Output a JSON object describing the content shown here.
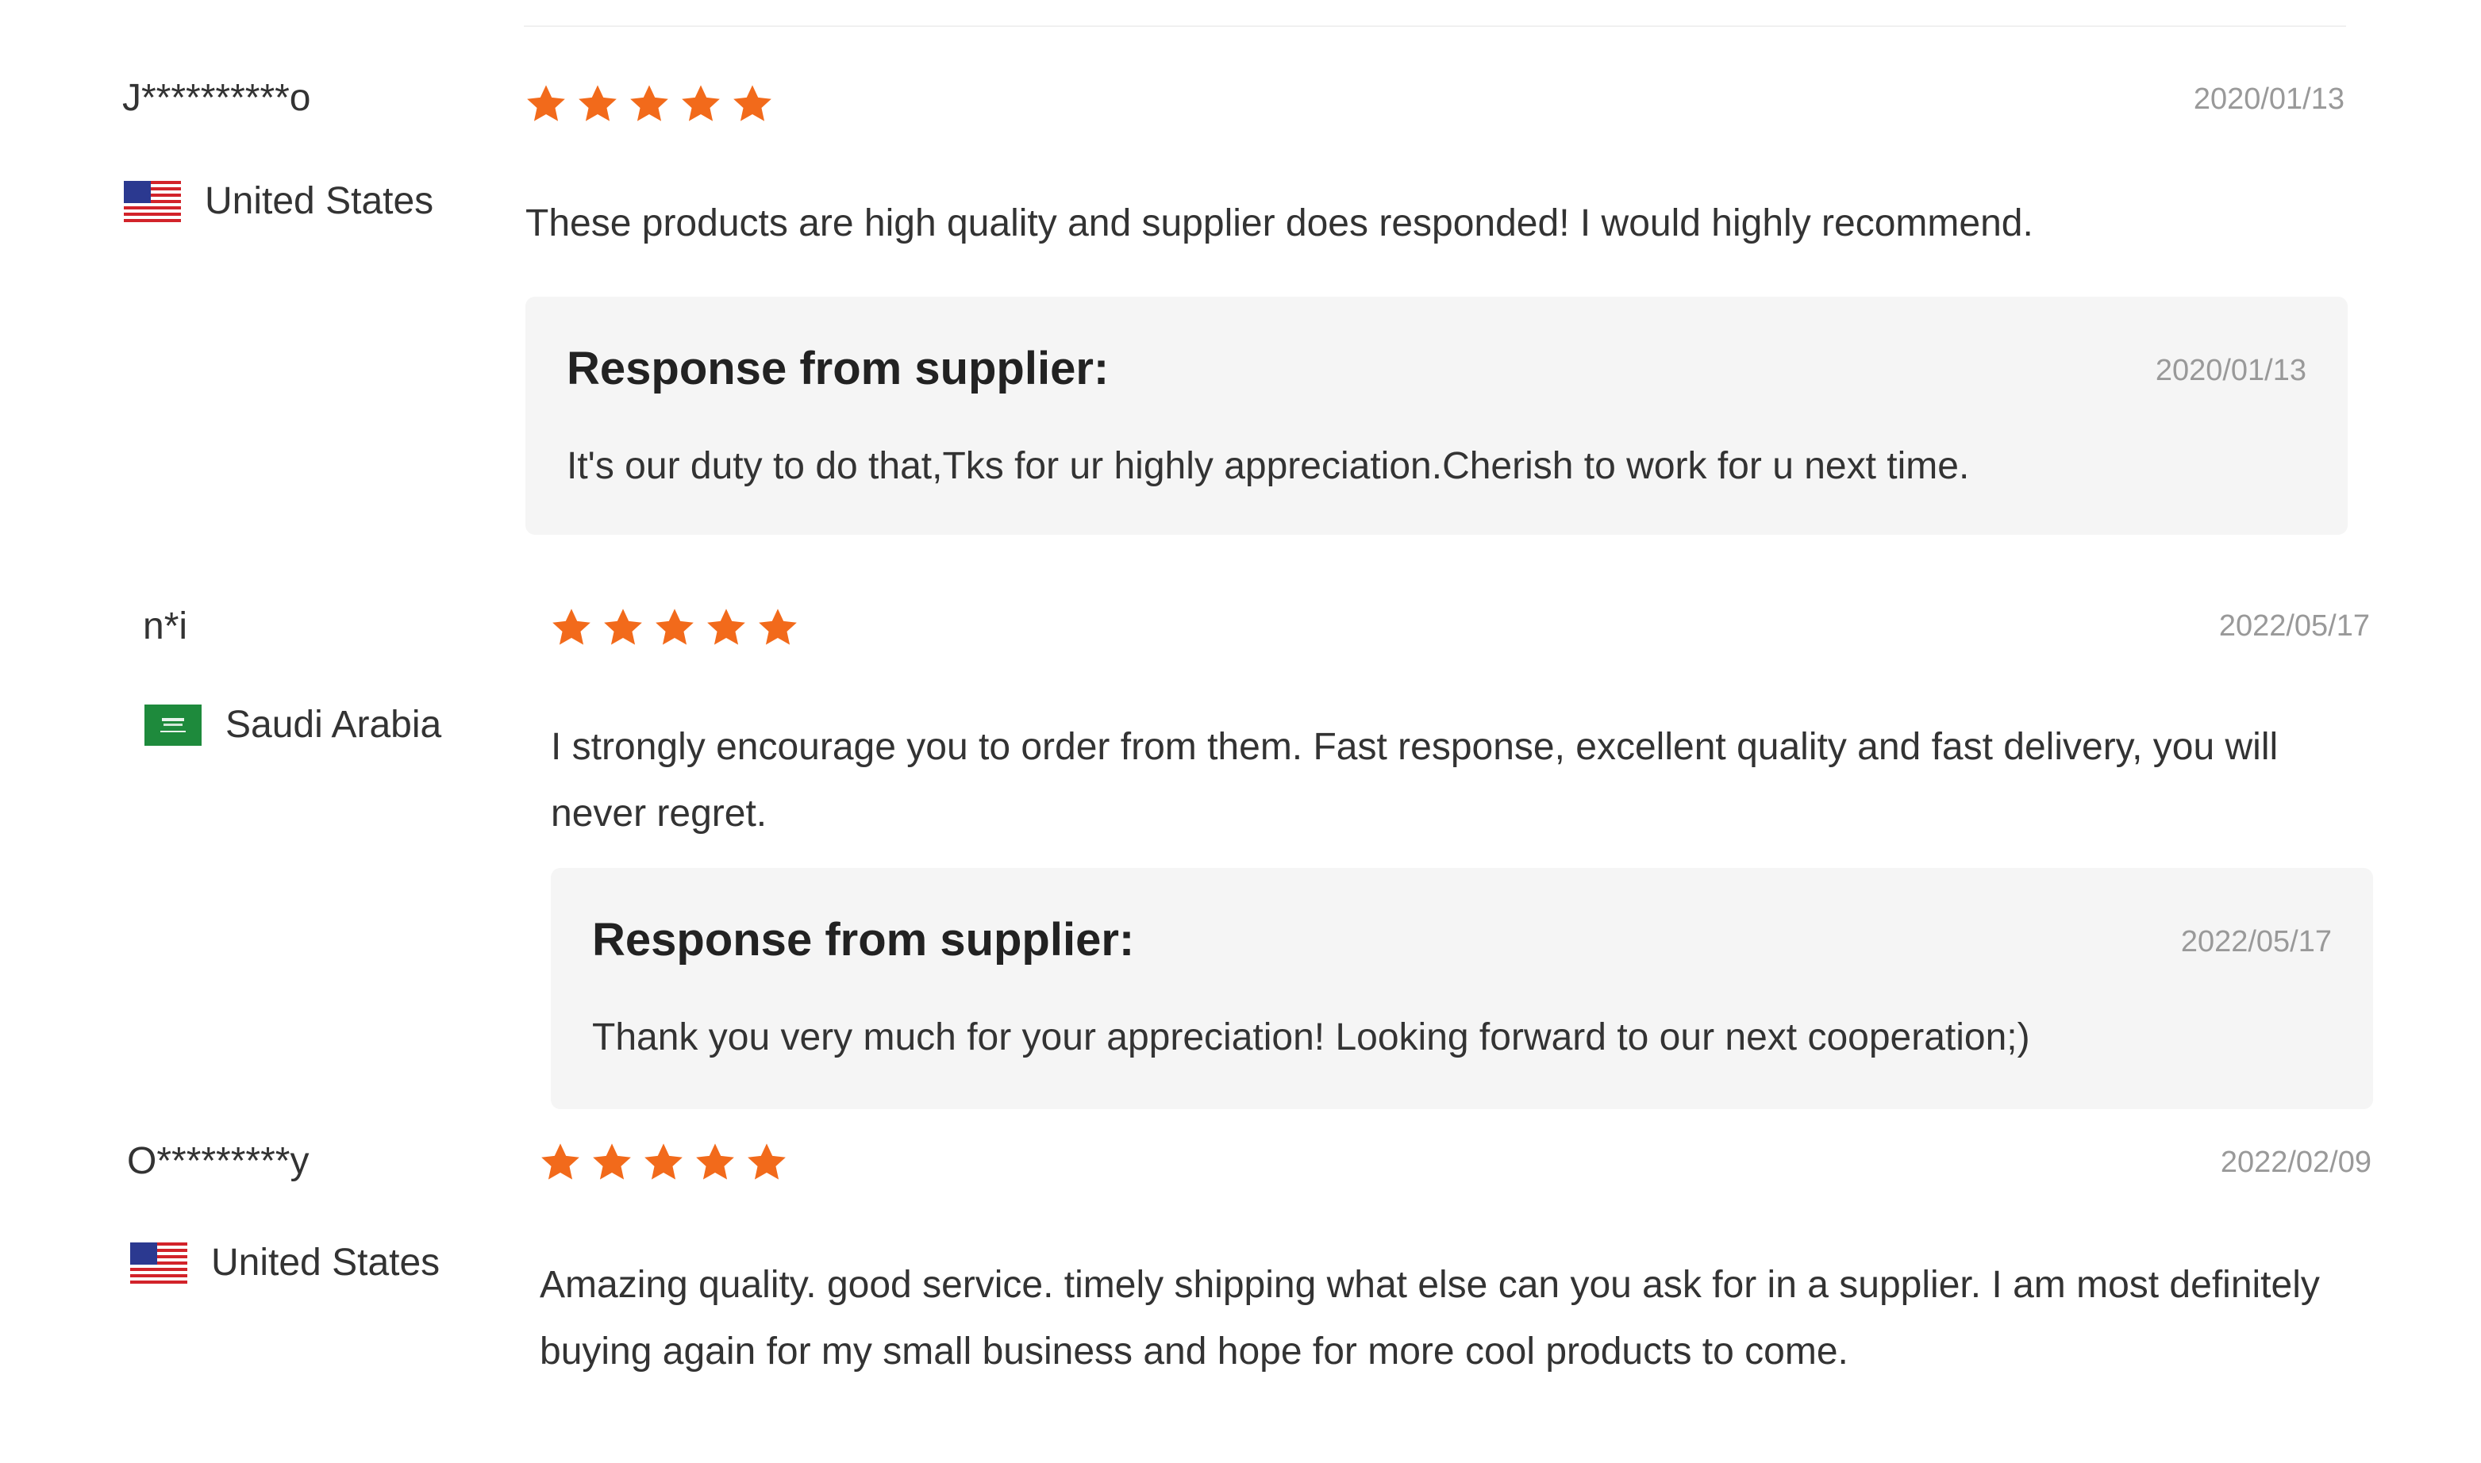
{
  "rating_scale_max": 5,
  "star_color": "#f26a1b",
  "reviews": [
    {
      "reviewer": "J**********o",
      "country": "United States",
      "flag": "us-flag-icon",
      "rating": 5,
      "date": "2020/01/13",
      "text": "These products are high quality and supplier does responded! I would highly recommend.",
      "response": {
        "title": "Response from supplier:",
        "date": "2020/01/13",
        "text": "It's our duty to do that,Tks for ur highly appreciation.Cherish to work for u next time."
      }
    },
    {
      "reviewer": "n*i",
      "country": "Saudi Arabia",
      "flag": "saudi-arabia-flag-icon",
      "rating": 5,
      "date": "2022/05/17",
      "text": "I strongly encourage you to order from them. Fast response, excellent quality and fast delivery, you will never regret.",
      "response": {
        "title": "Response from supplier:",
        "date": "2022/05/17",
        "text": "Thank you very much for your appreciation! Looking forward to our next cooperation;)"
      }
    },
    {
      "reviewer": "O*********y",
      "country": "United States",
      "flag": "us-flag-icon",
      "rating": 5,
      "date": "2022/02/09",
      "text": "Amazing quality. good service. timely shipping what else can you ask for in a supplier. I am most definitely buying again for my small business and hope for more cool products to come."
    }
  ]
}
